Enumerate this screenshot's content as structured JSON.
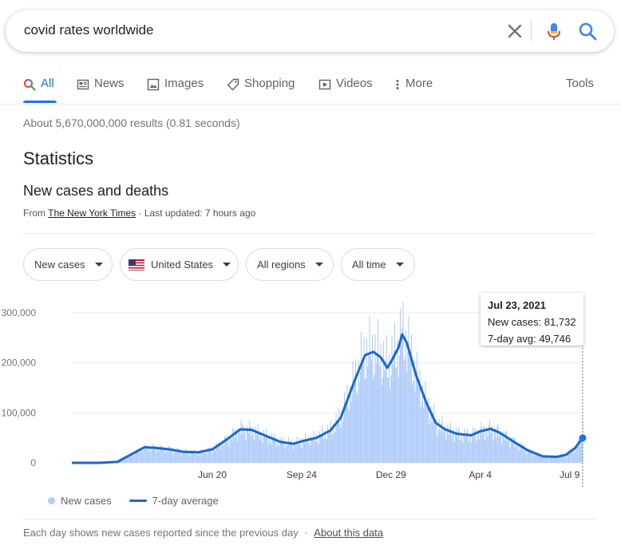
{
  "search": {
    "query": "covid rates worldwide"
  },
  "tabs": [
    {
      "label": "All",
      "icon": "search-icon"
    },
    {
      "label": "News",
      "icon": "news-icon"
    },
    {
      "label": "Images",
      "icon": "image-icon"
    },
    {
      "label": "Shopping",
      "icon": "tag-icon"
    },
    {
      "label": "Videos",
      "icon": "video-icon"
    },
    {
      "label": "More",
      "icon": "more-vert-icon"
    }
  ],
  "tools_label": "Tools",
  "result_stats": "About 5,670,000,000 results (0.81 seconds)",
  "statistics_heading": "Statistics",
  "subheading": "New cases and deaths",
  "source": {
    "prefix": "From",
    "link": "The New York Times",
    "suffix": "· Last updated: 7 hours ago"
  },
  "filters": [
    {
      "label": "New cases"
    },
    {
      "label": "United States",
      "icon": "us-flag-icon"
    },
    {
      "label": "All regions"
    },
    {
      "label": "All time"
    }
  ],
  "tooltip": {
    "date": "Jul 23, 2021",
    "new_cases": "New cases: 81,732",
    "avg": "7-day avg: 49,746"
  },
  "legend": {
    "cases": "New cases",
    "avg": "7-day average"
  },
  "footer": {
    "text": "Each day shows new cases reported since the previous day",
    "separator": "·",
    "link": "About this data"
  },
  "colors": {
    "accent": "#1a73e8",
    "bars": "#aecbfa",
    "line": "#1967d2"
  },
  "chart_data": {
    "type": "area",
    "ylim": [
      0,
      300000
    ],
    "y_ticks": [
      {
        "value": 0,
        "label": "0"
      },
      {
        "value": 100000,
        "label": "100,000"
      },
      {
        "value": 200000,
        "label": "200,000"
      },
      {
        "value": 300000,
        "label": "300,000"
      }
    ],
    "x_ticks": [
      {
        "date": "2020-06-20",
        "label": "Jun 20"
      },
      {
        "date": "2020-09-24",
        "label": "Sep 24"
      },
      {
        "date": "2020-12-29",
        "label": "Dec 29"
      },
      {
        "date": "2021-04-04",
        "label": "Apr 4"
      },
      {
        "date": "2021-07-09",
        "label": "Jul 9"
      }
    ],
    "series": [
      {
        "name": "7-day average",
        "points": [
          [
            "2020-01-21",
            0
          ],
          [
            "2020-02-20",
            0
          ],
          [
            "2020-03-10",
            2000
          ],
          [
            "2020-03-25",
            17000
          ],
          [
            "2020-04-08",
            31000
          ],
          [
            "2020-04-20",
            30000
          ],
          [
            "2020-05-05",
            27000
          ],
          [
            "2020-05-20",
            22000
          ],
          [
            "2020-06-05",
            21000
          ],
          [
            "2020-06-20",
            27000
          ],
          [
            "2020-07-05",
            46000
          ],
          [
            "2020-07-20",
            67000
          ],
          [
            "2020-08-01",
            66000
          ],
          [
            "2020-08-15",
            55000
          ],
          [
            "2020-09-01",
            42000
          ],
          [
            "2020-09-15",
            38000
          ],
          [
            "2020-09-24",
            43000
          ],
          [
            "2020-10-10",
            50000
          ],
          [
            "2020-10-25",
            65000
          ],
          [
            "2020-11-05",
            90000
          ],
          [
            "2020-11-20",
            165000
          ],
          [
            "2020-12-01",
            215000
          ],
          [
            "2020-12-10",
            222000
          ],
          [
            "2020-12-18",
            211000
          ],
          [
            "2020-12-25",
            190000
          ],
          [
            "2020-12-29",
            202000
          ],
          [
            "2021-01-06",
            230000
          ],
          [
            "2021-01-10",
            257000
          ],
          [
            "2021-01-15",
            240000
          ],
          [
            "2021-01-25",
            175000
          ],
          [
            "2021-02-05",
            120000
          ],
          [
            "2021-02-15",
            80000
          ],
          [
            "2021-02-25",
            67000
          ],
          [
            "2021-03-10",
            58000
          ],
          [
            "2021-03-25",
            55000
          ],
          [
            "2021-04-04",
            63000
          ],
          [
            "2021-04-15",
            68000
          ],
          [
            "2021-04-25",
            60000
          ],
          [
            "2021-05-10",
            42000
          ],
          [
            "2021-05-25",
            25000
          ],
          [
            "2021-06-10",
            13000
          ],
          [
            "2021-06-25",
            12000
          ],
          [
            "2021-07-05",
            16000
          ],
          [
            "2021-07-15",
            30000
          ],
          [
            "2021-07-23",
            49746
          ]
        ]
      },
      {
        "name": "New cases",
        "highlight": {
          "date": "2021-07-23",
          "value": 81732
        }
      }
    ]
  }
}
